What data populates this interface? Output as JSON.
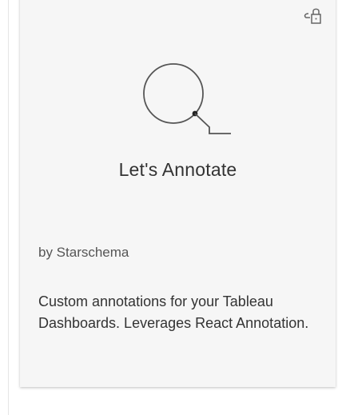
{
  "card": {
    "title": "Let's Annotate",
    "author": "by Starschema",
    "description": "Custom annotations for your Tableau Dashboards. Leverages React Annotation."
  },
  "icons": {
    "lock": "lock-icon",
    "logo": "annotation-logo-icon"
  }
}
